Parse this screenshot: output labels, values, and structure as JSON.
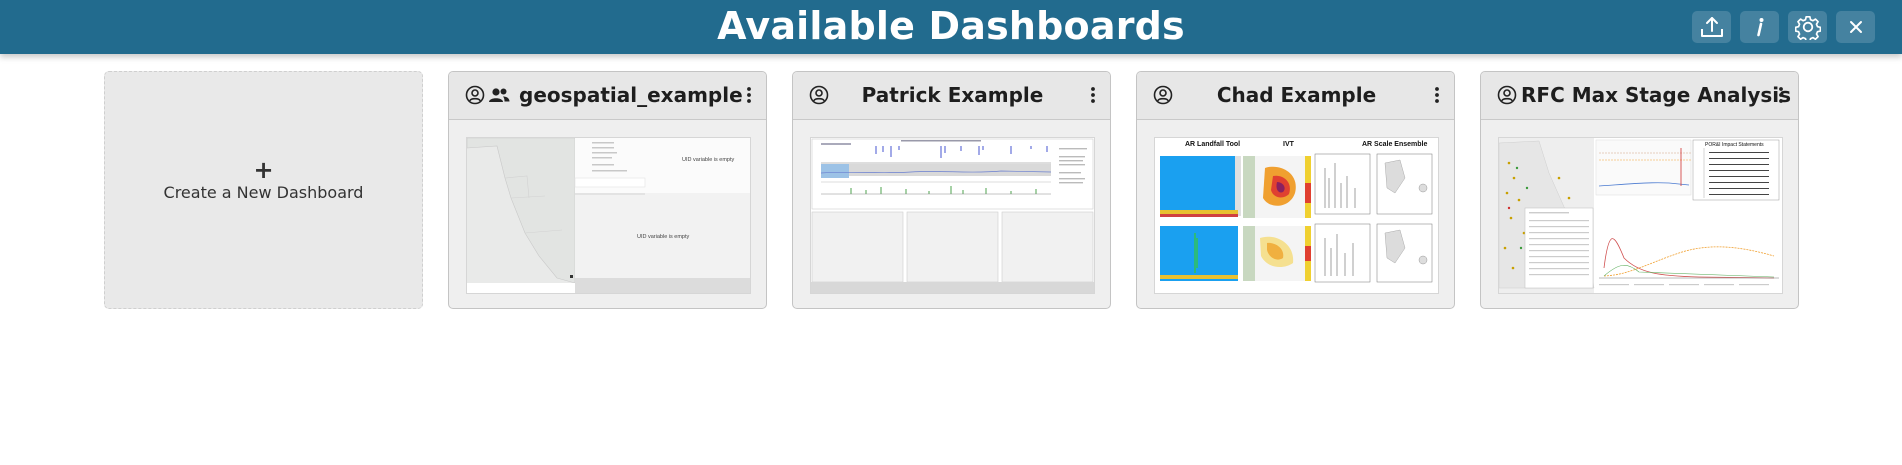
{
  "header": {
    "title": "Available Dashboards",
    "upload_icon": "upload-icon",
    "info_icon": "info-icon",
    "settings_icon": "gear-icon",
    "close_icon": "close-icon"
  },
  "create_card": {
    "plus": "+",
    "label": "Create a New Dashboard"
  },
  "dashboards": [
    {
      "title": "geospatial_example",
      "icons": [
        "user-circle-icon",
        "users-icon"
      ],
      "thumb_text": [
        "UID variable is empty",
        "UID variable is empty"
      ]
    },
    {
      "title": "Patrick Example",
      "icons": [
        "user-circle-icon"
      ]
    },
    {
      "title": "Chad Example",
      "icons": [
        "user-circle-icon"
      ],
      "thumb_text": [
        "AR Landfall Tool",
        "IVT",
        "AR Scale Ensemble"
      ]
    },
    {
      "title": "RFC Max Stage Analysis",
      "icons": [
        "user-circle-icon"
      ],
      "thumb_text": [
        "POR&I Impact Statements"
      ]
    }
  ],
  "colors": {
    "header_bg": "#226b8e",
    "card_bg": "#efefef",
    "card_head_bg": "#e7e7e7"
  }
}
